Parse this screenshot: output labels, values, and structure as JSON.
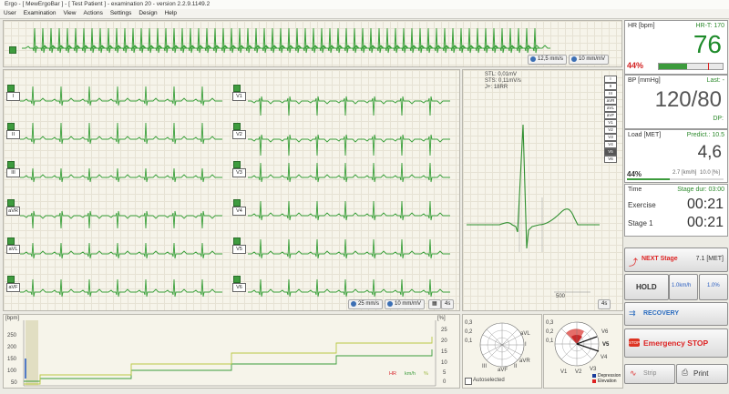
{
  "window": {
    "title": "Ergo - [ MewErgoBar ] - [ Test Patient ] - examination 20 - version 2.2.9.1149.2"
  },
  "menu": [
    "User",
    "Examination",
    "View",
    "Actions",
    "Settings",
    "Design",
    "Help"
  ],
  "rhythm": {
    "speed": "12,5 mm/s",
    "gain": "10 mm/mV"
  },
  "leads_left": [
    "I",
    "II",
    "III",
    "aVR",
    "aVL",
    "aVF"
  ],
  "leads_right": [
    "V1",
    "V2",
    "V3",
    "V4",
    "V5",
    "V6"
  ],
  "ecg_controls": {
    "speed": "25 mm/s",
    "gain": "10 mm/mV",
    "tag": "4s"
  },
  "avg": {
    "stl": "STL: 0,01mV",
    "sts": "STS: 0,11mV/s",
    "rr": "J+: 18RR",
    "scale": "500",
    "tag": "4s",
    "leads": [
      "I",
      "II",
      "III",
      "aVR",
      "aVL",
      "aVF",
      "V1",
      "V2",
      "V3",
      "V4",
      "V5",
      "V6"
    ],
    "selected": "V5"
  },
  "trend": {
    "left_unit": "[bpm]",
    "right_unit": "[%]",
    "left_ticks": [
      "250",
      "200",
      "150",
      "100",
      "50"
    ],
    "right_ticks": [
      "25",
      "20",
      "15",
      "10",
      "5",
      "0"
    ],
    "legend": {
      "hr": "HR",
      "kmh": "km/h",
      "pct": "%"
    },
    "colors": {
      "hr": "#d8262c",
      "kmh": "#3a9b3a",
      "pct": "#9ab63a"
    }
  },
  "polar1": {
    "labels": [
      "I",
      "aVL",
      "II",
      "aVF",
      "III",
      "aVR"
    ],
    "values": [
      "0,3",
      "0,2",
      "0,1"
    ],
    "checkbox": "Autoselected"
  },
  "polar2": {
    "labels": [
      "V6",
      "V5",
      "V4",
      "V3",
      "V2",
      "V1"
    ],
    "values": [
      "0,3",
      "0,2",
      "0,1"
    ],
    "legend": {
      "dep": "Depression",
      "elev": "Elevation"
    }
  },
  "hr": {
    "label": "HR [bpm]",
    "target": "HR-T: 170",
    "value": "76",
    "percent": "44%",
    "progress": 0.44
  },
  "bp": {
    "label": "BP [mmHg]",
    "last": "Last: -",
    "value": "120/80",
    "dp": "DP:"
  },
  "load": {
    "label": "Load [MET]",
    "predict": "Predict.: 10.5",
    "value": "4,6",
    "percent": "44%",
    "speed": "2.7 [km/h]",
    "grade": "10.0 [%]",
    "progress": 0.44
  },
  "time": {
    "label": "Time",
    "stage_dur": "Stage dur: 03:00",
    "exercise_label": "Exercise",
    "exercise_value": "00:21",
    "stage_label": "Stage 1",
    "stage_value": "00:21"
  },
  "buttons": {
    "next_stage": "NEXT Stage",
    "met": "7.1 [MET]",
    "hold": "HOLD",
    "speed": "1.0km/h",
    "grade": "1.0%",
    "recovery": "RECOVERY",
    "emergency": "Emergency STOP",
    "strip": "Strip",
    "print": "Print"
  }
}
